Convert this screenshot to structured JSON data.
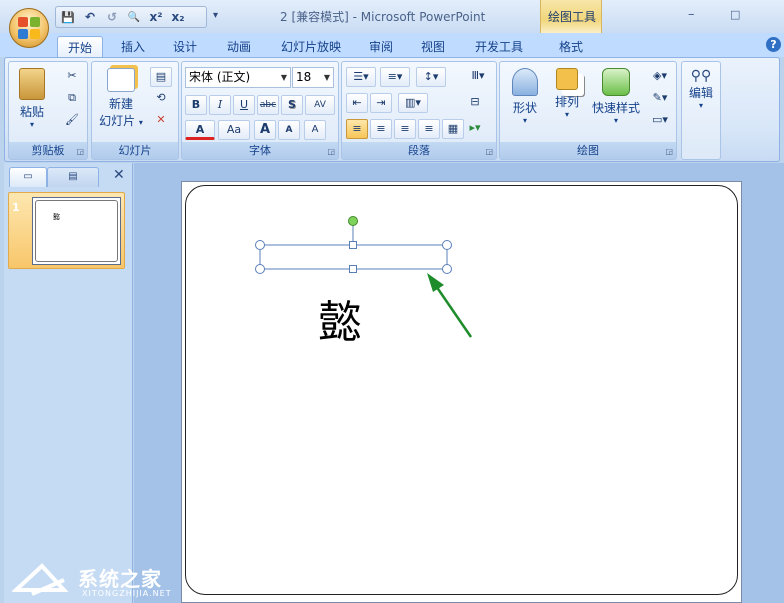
{
  "window": {
    "title": "2 [兼容模式] - Microsoft PowerPoint",
    "contextual_tab": "绘图工具",
    "minimize": "–",
    "restore": "□"
  },
  "qat": {
    "save": "💾",
    "undo": "↶",
    "redo": "↺",
    "preview": "🔍",
    "superscript": "x²",
    "subscript": "x₂",
    "more": "▾"
  },
  "tabs": [
    {
      "label": "开始",
      "active": true
    },
    {
      "label": "插入"
    },
    {
      "label": "设计"
    },
    {
      "label": "动画"
    },
    {
      "label": "幻灯片放映"
    },
    {
      "label": "审阅"
    },
    {
      "label": "视图"
    },
    {
      "label": "开发工具"
    },
    {
      "label": "格式"
    }
  ],
  "help": "?",
  "groups": {
    "clipboard": {
      "label": "剪贴板",
      "paste": "粘贴"
    },
    "slides": {
      "label": "幻灯片",
      "new_slide_line1": "新建",
      "new_slide_line2": "幻灯片"
    },
    "font": {
      "label": "字体",
      "font_name": "宋体 (正文)",
      "font_size": "18",
      "bold": "B",
      "italic": "I",
      "underline": "U",
      "strike": "abc",
      "shadow": "S",
      "spacing": "AV",
      "color": "A",
      "case": "Aa",
      "grow": "A",
      "shrink": "A",
      "clear": "A"
    },
    "paragraph": {
      "label": "段落"
    },
    "drawing": {
      "label": "绘图",
      "shapes": "形状",
      "arrange": "排列",
      "quick_styles": "快速样式"
    },
    "editing": {
      "label": "",
      "edit": "编辑"
    }
  },
  "slide": {
    "number": "1",
    "character": "懿"
  },
  "watermark": {
    "text": "系统之家",
    "sub": "XITONGZHIJIA.NET"
  },
  "colors": {
    "accent": "#15428b",
    "arrow": "#1e8c2a",
    "selection": "#5a7fb8"
  }
}
